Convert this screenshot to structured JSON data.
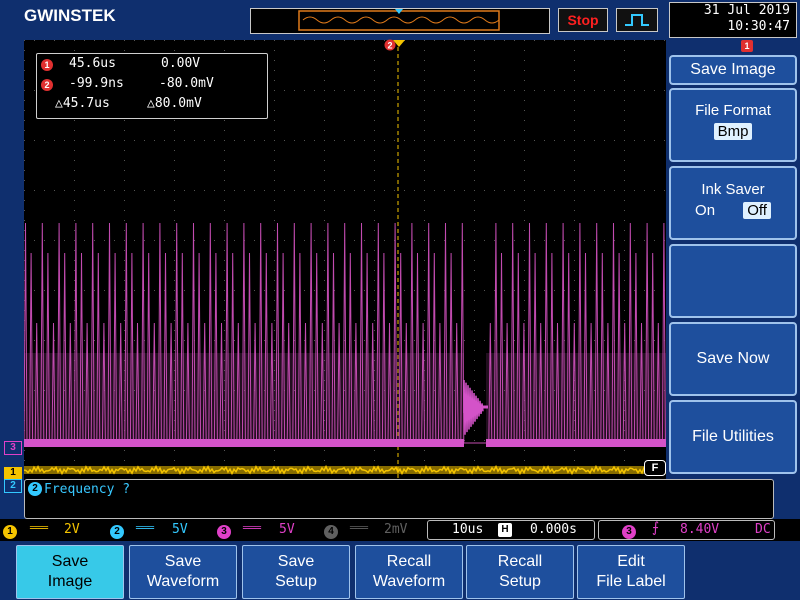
{
  "header": {
    "brand": "GWINSTEK",
    "run_state": "Stop",
    "date": "31 Jul 2019",
    "time": "10:30:47"
  },
  "cursors": {
    "c1_time": "45.6us",
    "c1_volt": "0.00V",
    "c2_time": "-99.9ns",
    "c2_volt": "-80.0mV",
    "delta_time": "△45.7us",
    "delta_volt": "△80.0mV"
  },
  "side_menu": {
    "title": "Save Image",
    "file_format_label": "File Format",
    "file_format_value": "Bmp",
    "ink_saver_label": "Ink Saver",
    "ink_on": "On",
    "ink_off": "Off",
    "save_now": "Save Now",
    "file_utilities": "File Utilities"
  },
  "message": "Frequency ?",
  "status_bar": {
    "ch1_scale": "2V",
    "ch2_scale": "5V",
    "ch3_scale": "5V",
    "ch4_scale": "2mV",
    "timebase": "10us",
    "h_position": "0.000s",
    "trigger_level": "8.40V",
    "coupling": "DC",
    "ch1_color": "#f5c400",
    "ch2_color": "#33c9ff",
    "ch3_color": "#e040c8",
    "ch4_color": "#606060"
  },
  "bottom_menu": [
    {
      "line1": "Save",
      "line2": "Image"
    },
    {
      "line1": "Save",
      "line2": "Waveform"
    },
    {
      "line1": "Save",
      "line2": "Setup"
    },
    {
      "line1": "Recall",
      "line2": "Waveform"
    },
    {
      "line1": "Recall",
      "line2": "Setup"
    },
    {
      "line1": "Edit",
      "line2": "File Label"
    }
  ],
  "markers": {
    "ch3": "3",
    "ch1": "1",
    "ch2": "2",
    "force": "F",
    "cursor2": "2",
    "cursor1": "1"
  }
}
